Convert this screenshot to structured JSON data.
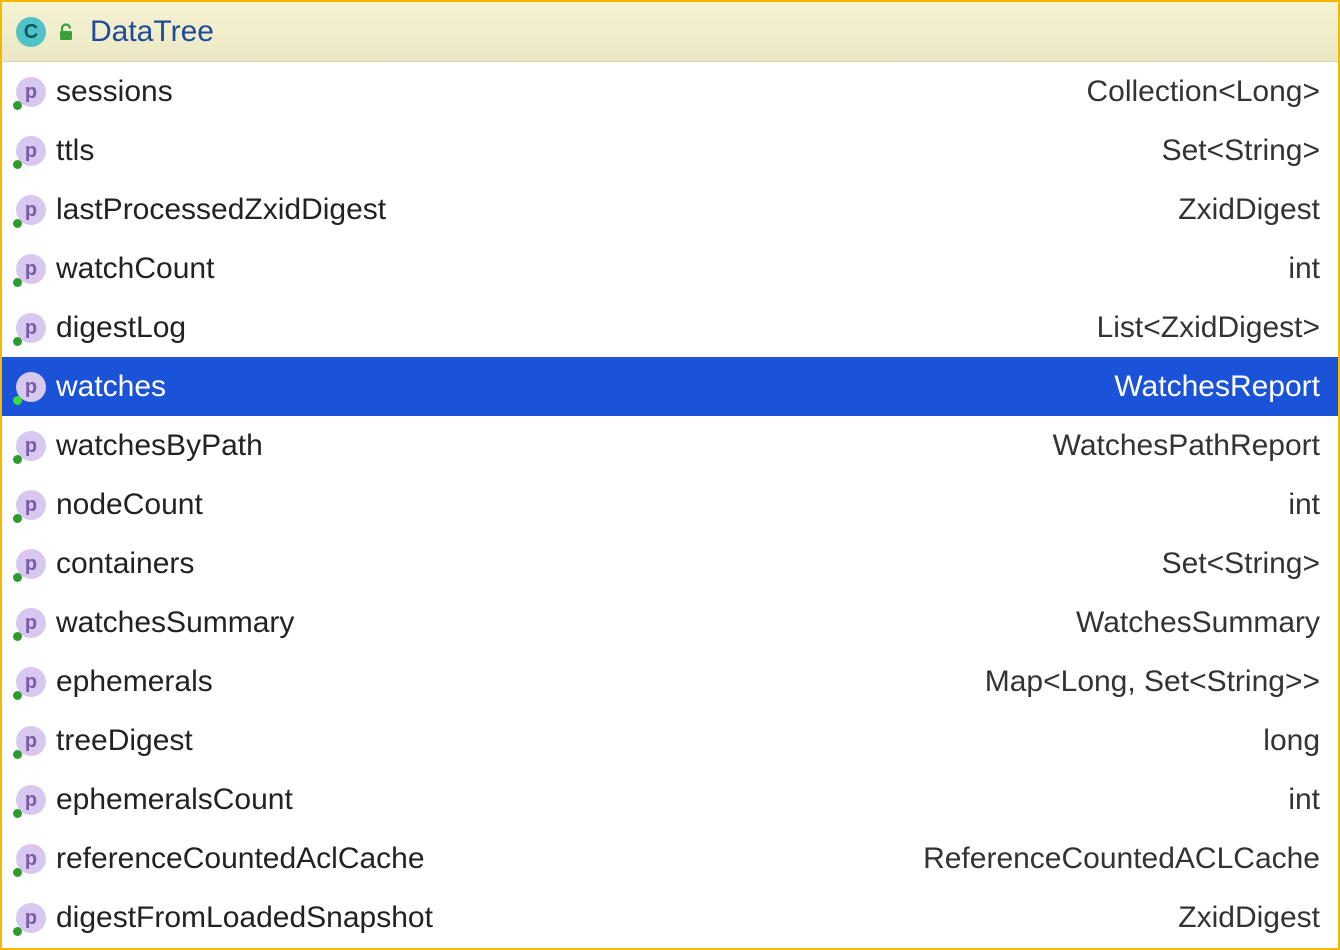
{
  "header": {
    "class_icon_letter": "C",
    "title": "DataTree"
  },
  "properties": [
    {
      "icon_letter": "p",
      "name": "sessions",
      "type": "Collection<Long>",
      "selected": false
    },
    {
      "icon_letter": "p",
      "name": "ttls",
      "type": "Set<String>",
      "selected": false
    },
    {
      "icon_letter": "p",
      "name": "lastProcessedZxidDigest",
      "type": "ZxidDigest",
      "selected": false
    },
    {
      "icon_letter": "p",
      "name": "watchCount",
      "type": "int",
      "selected": false
    },
    {
      "icon_letter": "p",
      "name": "digestLog",
      "type": "List<ZxidDigest>",
      "selected": false
    },
    {
      "icon_letter": "p",
      "name": "watches",
      "type": "WatchesReport",
      "selected": true
    },
    {
      "icon_letter": "p",
      "name": "watchesByPath",
      "type": "WatchesPathReport",
      "selected": false
    },
    {
      "icon_letter": "p",
      "name": "nodeCount",
      "type": "int",
      "selected": false
    },
    {
      "icon_letter": "p",
      "name": "containers",
      "type": "Set<String>",
      "selected": false
    },
    {
      "icon_letter": "p",
      "name": "watchesSummary",
      "type": "WatchesSummary",
      "selected": false
    },
    {
      "icon_letter": "p",
      "name": "ephemerals",
      "type": "Map<Long, Set<String>>",
      "selected": false
    },
    {
      "icon_letter": "p",
      "name": "treeDigest",
      "type": "long",
      "selected": false
    },
    {
      "icon_letter": "p",
      "name": "ephemeralsCount",
      "type": "int",
      "selected": false
    },
    {
      "icon_letter": "p",
      "name": "referenceCountedAclCache",
      "type": "ReferenceCountedACLCache",
      "selected": false
    },
    {
      "icon_letter": "p",
      "name": "digestFromLoadedSnapshot",
      "type": "ZxidDigest",
      "selected": false
    }
  ]
}
